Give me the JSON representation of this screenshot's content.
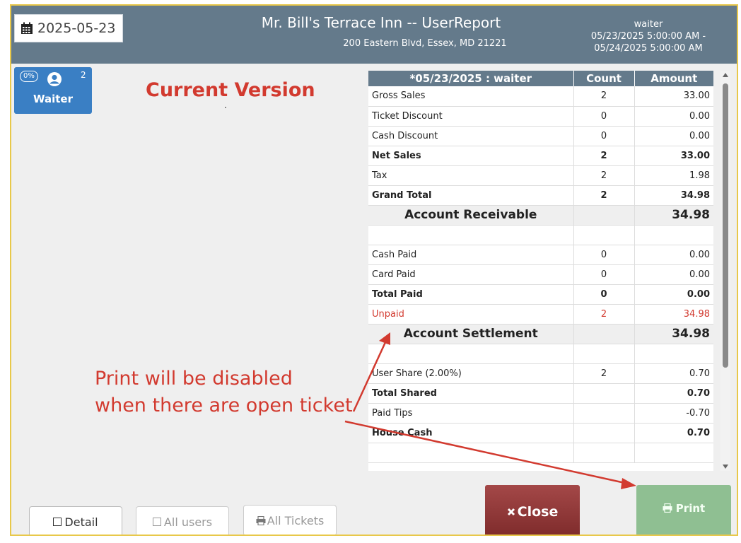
{
  "header": {
    "date_value": "2025-05-23",
    "title": "Mr. Bill's Terrace Inn -- UserReport",
    "address": "200 Eastern Blvd, Essex, MD 21221",
    "user": "waiter",
    "range_line1": "05/23/2025 5:00:00 AM -",
    "range_line2": "05/24/2025 5:00:00 AM",
    "calendar_icon": "calendar-icon"
  },
  "sidebar": {
    "waiter_button": {
      "percent": "0%",
      "count": "2",
      "label": "Waiter",
      "icon": "user-icon"
    }
  },
  "annotation": {
    "current_version": "Current Version",
    "note_line1": "Print will be disabled",
    "note_line2": "when there are open ticket"
  },
  "report": {
    "columns": [
      "*05/23/2025 : waiter",
      "Count",
      "Amount"
    ],
    "rows": [
      {
        "label": "Gross Sales",
        "count": "2",
        "amount": "33.00"
      },
      {
        "label": "Ticket Discount",
        "count": "0",
        "amount": "0.00"
      },
      {
        "label": "Cash Discount",
        "count": "0",
        "amount": "0.00"
      },
      {
        "label": "Net Sales",
        "count": "2",
        "amount": "33.00"
      },
      {
        "label": "Tax",
        "count": "2",
        "amount": "1.98"
      },
      {
        "label": "Grand Total",
        "count": "2",
        "amount": "34.98"
      },
      {
        "label": "Account Receivable",
        "count": "",
        "amount": "34.98"
      },
      {
        "label": "",
        "count": "",
        "amount": ""
      },
      {
        "label": "Cash Paid",
        "count": "0",
        "amount": "0.00"
      },
      {
        "label": "Card Paid",
        "count": "0",
        "amount": "0.00"
      },
      {
        "label": "Total Paid",
        "count": "0",
        "amount": "0.00"
      },
      {
        "label": "Unpaid",
        "count": "2",
        "amount": "34.98"
      },
      {
        "label": "Account Settlement",
        "count": "",
        "amount": "34.98"
      },
      {
        "label": "",
        "count": "",
        "amount": ""
      },
      {
        "label": "User Share (2.00%)",
        "count": "2",
        "amount": "0.70"
      },
      {
        "label": "Total Shared",
        "count": "",
        "amount": "0.70"
      },
      {
        "label": "Paid Tips",
        "count": "",
        "amount": "-0.70"
      },
      {
        "label": "House Cash",
        "count": "",
        "amount": "0.70"
      },
      {
        "label": "",
        "count": "",
        "amount": ""
      }
    ]
  },
  "footer": {
    "detail_label": "Detail",
    "all_users_label": "All users",
    "all_tickets_label": "All Tickets",
    "close_label": "Close",
    "print_label": "Print",
    "print_icon": "printer-icon",
    "close_icon": "x-icon"
  },
  "colors": {
    "header_bg": "#647a8b",
    "accent_red": "#d23a2f",
    "waiter_blue": "#3a7fc4",
    "close_red": "#8e3838",
    "print_green": "#8fbf92",
    "frame_border": "#e8c84a"
  }
}
